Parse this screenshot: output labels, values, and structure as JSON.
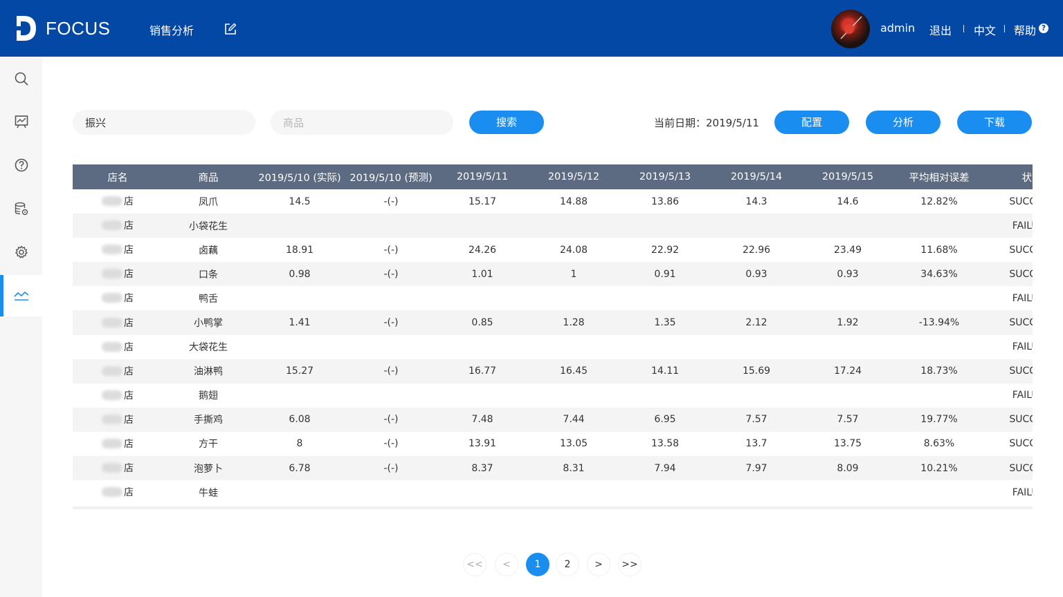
{
  "header": {
    "brand": "FOCUS",
    "nav_title": "销售分析",
    "user": "admin",
    "logout": "退出",
    "language": "中文",
    "help": "帮助",
    "help_mark": "?",
    "colors": {
      "topbar": "#0448a6",
      "accent": "#1a8ef0"
    }
  },
  "sidebar": {
    "items": [
      {
        "icon": "search-icon"
      },
      {
        "icon": "presentation-chart-icon"
      },
      {
        "icon": "help-circle-icon"
      },
      {
        "icon": "database-gear-icon"
      },
      {
        "icon": "settings-gear-icon"
      },
      {
        "icon": "trend-line-icon",
        "active": true
      }
    ]
  },
  "filters": {
    "store_value": "振兴",
    "product_placeholder": "商品",
    "search_label": "搜索",
    "current_date_label": "当前日期：2019/5/11",
    "config_label": "配置",
    "analyze_label": "分析",
    "download_label": "下载"
  },
  "table": {
    "columns": [
      "店名",
      "商品",
      "2019/5/10 (实际)",
      "2019/5/10 (预测)",
      "2019/5/11",
      "2019/5/12",
      "2019/5/13",
      "2019/5/14",
      "2019/5/15",
      "平均相对误差",
      "状态"
    ],
    "rows": [
      [
        "店",
        "凤爪",
        "14.5",
        "-(-)",
        "15.17",
        "14.88",
        "13.86",
        "14.3",
        "14.6",
        "12.82%",
        "SUCCESS"
      ],
      [
        "店",
        "小袋花生",
        "",
        "",
        "",
        "",
        "",
        "",
        "",
        "",
        "FAILURE"
      ],
      [
        "店",
        "卤藕",
        "18.91",
        "-(-)",
        "24.26",
        "24.08",
        "22.92",
        "22.96",
        "23.49",
        "11.68%",
        "SUCCESS"
      ],
      [
        "店",
        "口条",
        "0.98",
        "-(-)",
        "1.01",
        "1",
        "0.91",
        "0.93",
        "0.93",
        "34.63%",
        "SUCCESS"
      ],
      [
        "店",
        "鸭舌",
        "",
        "",
        "",
        "",
        "",
        "",
        "",
        "",
        "FAILURE"
      ],
      [
        "店",
        "小鸭掌",
        "1.41",
        "-(-)",
        "0.85",
        "1.28",
        "1.35",
        "2.12",
        "1.92",
        "-13.94%",
        "SUCCESS"
      ],
      [
        "店",
        "大袋花生",
        "",
        "",
        "",
        "",
        "",
        "",
        "",
        "",
        "FAILURE"
      ],
      [
        "店",
        "油淋鸭",
        "15.27",
        "-(-)",
        "16.77",
        "16.45",
        "14.11",
        "15.69",
        "17.24",
        "18.73%",
        "SUCCESS"
      ],
      [
        "店",
        "鹅翅",
        "",
        "",
        "",
        "",
        "",
        "",
        "",
        "",
        "FAILURE"
      ],
      [
        "店",
        "手撕鸡",
        "6.08",
        "-(-)",
        "7.48",
        "7.44",
        "6.95",
        "7.57",
        "7.57",
        "19.77%",
        "SUCCESS"
      ],
      [
        "店",
        "方干",
        "8",
        "-(-)",
        "13.91",
        "13.05",
        "13.58",
        "13.7",
        "13.75",
        "8.63%",
        "SUCCESS"
      ],
      [
        "店",
        "泡萝卜",
        "6.78",
        "-(-)",
        "8.37",
        "8.31",
        "7.94",
        "7.97",
        "8.09",
        "10.21%",
        "SUCCESS"
      ],
      [
        "店",
        "牛蛙",
        "",
        "",
        "",
        "",
        "",
        "",
        "",
        "",
        "FAILURE"
      ]
    ]
  },
  "pagination": {
    "first": "<<",
    "prev": "<",
    "pages": [
      "1",
      "2"
    ],
    "current": "1",
    "next": ">",
    "last": ">>"
  }
}
